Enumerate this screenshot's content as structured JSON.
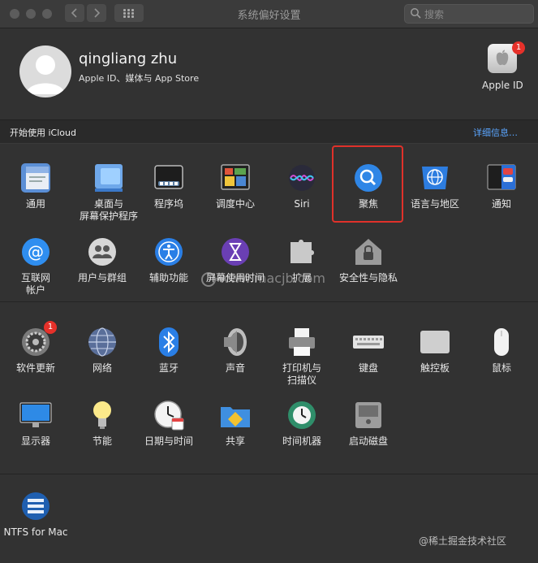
{
  "window": {
    "title": "系统偏好设置",
    "search_placeholder": "搜索"
  },
  "user": {
    "name": "qingliang zhu",
    "subtitle": "Apple ID、媒体与 App Store",
    "appleid_label": "Apple ID",
    "appleid_badge": "1"
  },
  "icloud": {
    "prompt": "开始使用 iCloud",
    "details_link": "详细信息…"
  },
  "section1": [
    {
      "label": "通用",
      "icon": "general-icon"
    },
    {
      "label": "桌面与\n屏幕保护程序",
      "icon": "desktop-screensaver-icon"
    },
    {
      "label": "程序坞",
      "icon": "dock-icon"
    },
    {
      "label": "调度中心",
      "icon": "mission-control-icon"
    },
    {
      "label": "Siri",
      "icon": "siri-icon"
    },
    {
      "label": "聚焦",
      "icon": "spotlight-icon"
    },
    {
      "label": "语言与地区",
      "icon": "language-region-icon"
    },
    {
      "label": "通知",
      "icon": "notifications-icon"
    },
    {
      "label": "互联网\n帐户",
      "icon": "internet-accounts-icon"
    },
    {
      "label": "用户与群组",
      "icon": "users-groups-icon"
    },
    {
      "label": "辅助功能",
      "icon": "accessibility-icon"
    },
    {
      "label": "屏幕使用时间",
      "icon": "screen-time-icon"
    },
    {
      "label": "扩展",
      "icon": "extensions-icon"
    },
    {
      "label": "安全性与隐私",
      "icon": "security-privacy-icon"
    }
  ],
  "section2": [
    {
      "label": "软件更新",
      "icon": "software-update-icon",
      "badge": "1"
    },
    {
      "label": "网络",
      "icon": "network-icon"
    },
    {
      "label": "蓝牙",
      "icon": "bluetooth-icon"
    },
    {
      "label": "声音",
      "icon": "sound-icon"
    },
    {
      "label": "打印机与\n扫描仪",
      "icon": "printers-scanners-icon"
    },
    {
      "label": "键盘",
      "icon": "keyboard-icon"
    },
    {
      "label": "触控板",
      "icon": "trackpad-icon"
    },
    {
      "label": "鼠标",
      "icon": "mouse-icon"
    },
    {
      "label": "显示器",
      "icon": "displays-icon"
    },
    {
      "label": "节能",
      "icon": "energy-saver-icon"
    },
    {
      "label": "日期与时间",
      "icon": "date-time-icon"
    },
    {
      "label": "共享",
      "icon": "sharing-icon"
    },
    {
      "label": "时间机器",
      "icon": "time-machine-icon"
    },
    {
      "label": "启动磁盘",
      "icon": "startup-disk-icon"
    }
  ],
  "section3": [
    {
      "label": "NTFS for Mac",
      "icon": "ntfs-icon"
    }
  ],
  "overlay": {
    "watermark": "www.macjb.com",
    "credit": "@稀土掘金技术社区"
  },
  "colors": {
    "highlight": "#e0312a",
    "link": "#5aa5ff",
    "background": "#323232"
  }
}
